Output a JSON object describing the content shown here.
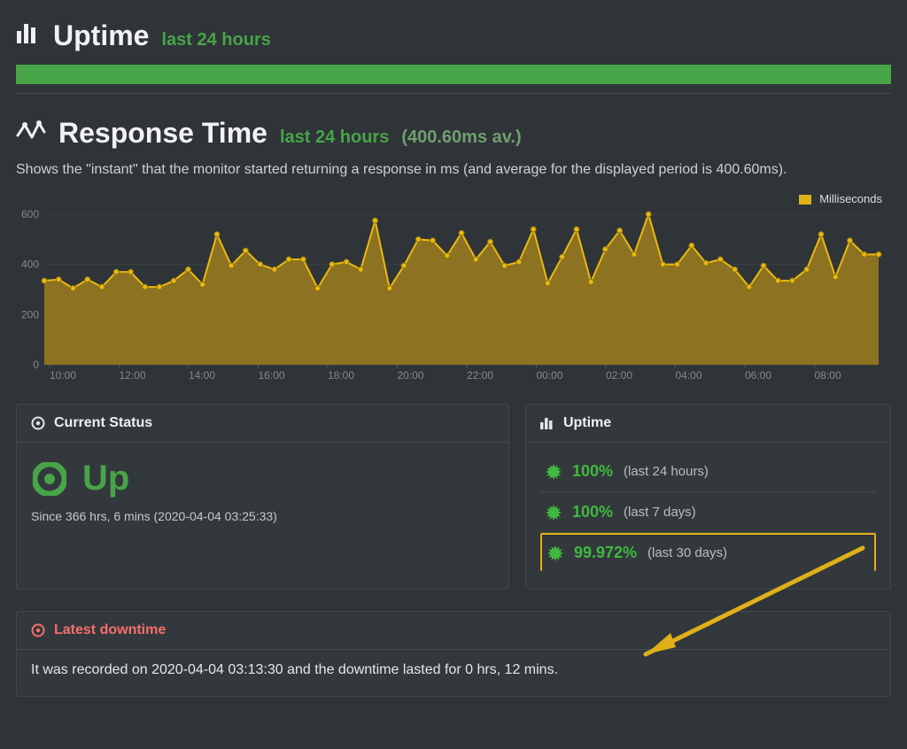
{
  "uptime_section": {
    "title": "Uptime",
    "subtitle": "last 24 hours"
  },
  "response_section": {
    "title": "Response Time",
    "subtitle": "last 24 hours",
    "subtitle_meta": "(400.60ms av.)",
    "description": "Shows the \"instant\" that the monitor started returning a response in ms (and average for the displayed period is 400.60ms)."
  },
  "legend_label": "Milliseconds",
  "status_card": {
    "header": "Current Status",
    "status_value": "Up",
    "since_text": "Since 366 hrs, 6 mins (2020-04-04 03:25:33)"
  },
  "uptime_card": {
    "header": "Uptime",
    "rows": [
      {
        "pct": "100%",
        "period": "(last 24 hours)"
      },
      {
        "pct": "100%",
        "period": "(last 7 days)"
      },
      {
        "pct": "99.972%",
        "period": "(last 30 days)"
      }
    ]
  },
  "downtime_panel": {
    "header": "Latest downtime",
    "text": "It was recorded on 2020-04-04 03:13:30 and the downtime lasted for 0 hrs, 12 mins."
  },
  "chart_data": {
    "type": "area",
    "title": "Response Time last 24 hours (400.60ms av.)",
    "ylabel": "Milliseconds",
    "ylim": [
      0,
      600
    ],
    "yticks": [
      0,
      200,
      400,
      600
    ],
    "x_tick_labels": [
      "10:00",
      "12:00",
      "14:00",
      "16:00",
      "18:00",
      "20:00",
      "22:00",
      "00:00",
      "02:00",
      "04:00",
      "06:00",
      "08:00"
    ],
    "series": [
      {
        "name": "Milliseconds",
        "color": "#e0b018",
        "values": [
          335,
          340,
          305,
          340,
          310,
          370,
          370,
          310,
          310,
          335,
          380,
          320,
          520,
          395,
          455,
          400,
          380,
          420,
          420,
          305,
          400,
          410,
          380,
          575,
          305,
          395,
          500,
          495,
          435,
          525,
          420,
          490,
          395,
          410,
          540,
          325,
          430,
          540,
          330,
          460,
          535,
          440,
          600,
          400,
          400,
          475,
          405,
          420,
          380,
          310,
          395,
          335,
          335,
          380,
          520,
          350,
          495,
          440,
          440
        ]
      }
    ]
  }
}
